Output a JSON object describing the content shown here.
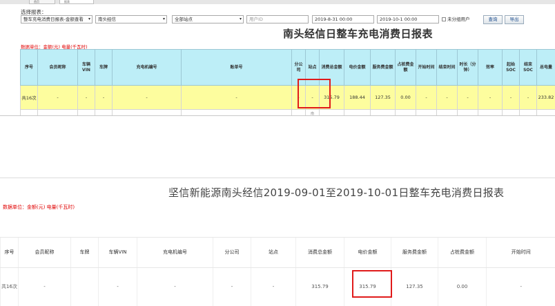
{
  "top": {
    "tabs": [
      "首页",
      "报表"
    ],
    "select_label": "选择报表：",
    "filters": {
      "report_type": "整车充电消费日报表-金额查看",
      "area": "南头经信",
      "station": "全部站点",
      "user_id_placeholder": "用户ID",
      "start_time": "2019-8-31 00:00",
      "end_time": "2019-10-1 00:00",
      "unassigned_label": "未分组用户"
    },
    "buttons": {
      "query": "查询",
      "export": "导出"
    },
    "report_title": "南头经信日整车充电消费日报表",
    "unit_note": "数据单位：金额(元)   电量(千瓦时)",
    "headers": [
      "序号",
      "会员昵称",
      "车辆VIN",
      "车牌",
      "充电机编号",
      "账单号",
      "分公司",
      "站点",
      "消费总金额",
      "电价金额",
      "服务费金额",
      "占桩费金额",
      "开始时间",
      "结束时间",
      "时长（分钟）",
      "效率",
      "起始SOC",
      "结束SOC",
      "总电量"
    ],
    "total_row": [
      "共16次",
      "-",
      "-",
      "-",
      "-",
      "-",
      "-",
      "-",
      "315.79",
      "188.44",
      "127.35",
      "0.00",
      "-",
      "-",
      "-",
      "-",
      "-",
      "-",
      "233.82"
    ],
    "next_row_hint": "南"
  },
  "bottom": {
    "report_title": "坚信新能源南头经信2019-09-01至2019-10-01日整车充电消费日报表",
    "unit_note": "数据单位：金额(元)   电量(千瓦时)",
    "headers": [
      "序号",
      "会员昵称",
      "车牌",
      "车辆VIN",
      "充电机编号",
      "分公司",
      "站点",
      "消费总金额",
      "电价金额",
      "服务费金额",
      "占桩费金额",
      "开始时间"
    ],
    "total_row": [
      "共16次",
      "-",
      "",
      "-",
      "-",
      "-",
      "-",
      "315.79",
      "315.79",
      "127.35",
      "0.00",
      "-"
    ]
  },
  "colors": {
    "header_bg": "#bdeef7",
    "total_bg": "#fdfd9e",
    "highlight": "#e01a1a",
    "unit_text": "#e00000"
  }
}
